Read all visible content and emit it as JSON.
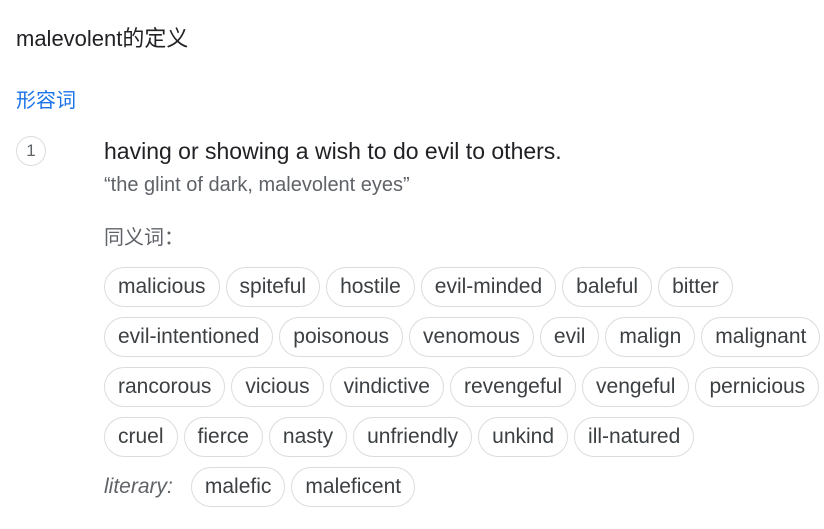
{
  "header": {
    "title": "malevolent的定义"
  },
  "entry": {
    "part_of_speech": "形容词",
    "sense_number": "1",
    "definition": "having or showing a wish to do evil to others.",
    "example": "“the glint of dark, malevolent eyes”",
    "synonyms_label": "同义词：",
    "synonym_rows": [
      [
        "malicious",
        "spiteful",
        "hostile",
        "evil-minded",
        "baleful",
        "bitter"
      ],
      [
        "evil-intentioned",
        "poisonous",
        "venomous",
        "evil",
        "malign",
        "malignant"
      ],
      [
        "rancorous",
        "vicious",
        "vindictive",
        "revengeful",
        "vengeful",
        "pernicious"
      ],
      [
        "cruel",
        "fierce",
        "nasty",
        "unfriendly",
        "unkind",
        "ill-natured"
      ]
    ],
    "literary_label": "literary:",
    "literary_synonyms": [
      "malefic",
      "maleficent"
    ]
  }
}
